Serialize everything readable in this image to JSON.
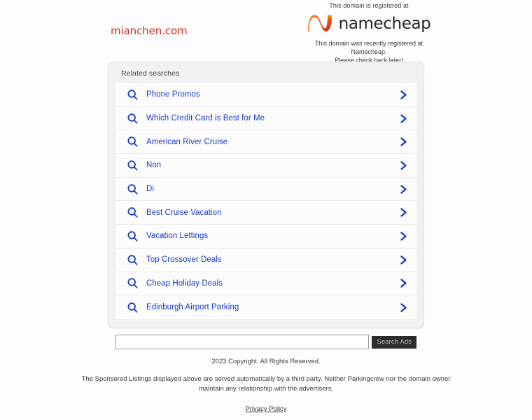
{
  "page": {
    "domain_name": "mianchen.com",
    "domain_color": "#d9291c",
    "background": "#fdfdfd"
  },
  "registrar_banner": {
    "tagline": "This domain is registered at",
    "brand_name": "namecheap",
    "logo_icon": "namecheap-n-logo",
    "logo_color_start": "#ff8a00",
    "logo_color_end": "#de3723",
    "note_line_1": "This domain was recently registered at Namecheap.",
    "note_line_2": "Please check back later!"
  },
  "related_searches": {
    "title": "Related searches",
    "link_color": "#1a3dc4",
    "search_icon": "search-icon",
    "chevron_icon": "chevron-right-icon",
    "items": [
      {
        "label": "Phone Promos"
      },
      {
        "label": "Which Credit Card is Best for Me"
      },
      {
        "label": "American River Cruise"
      },
      {
        "label": "Non"
      },
      {
        "label": "Di"
      },
      {
        "label": "Best Cruise Vacation"
      },
      {
        "label": "Vacation Lettings"
      },
      {
        "label": "Top Crossover Deals"
      },
      {
        "label": "Cheap Holiday Deals"
      },
      {
        "label": "Edinburgh Airport Parking"
      }
    ]
  },
  "search_form": {
    "input_value": "",
    "input_placeholder": "",
    "button_label": "Search Ads",
    "button_bg": "#2d2d2d",
    "button_text_color": "#b9b9b9"
  },
  "footer": {
    "copyright": "2023 Copyright. All Rights Reserved.",
    "disclaimer": "The Sponsored Listings displayed above are served automatically by a third party. Neither Parkingcrew nor the domain owner maintain any relationship with the advertisers.",
    "privacy_policy": "Privacy Policy"
  }
}
